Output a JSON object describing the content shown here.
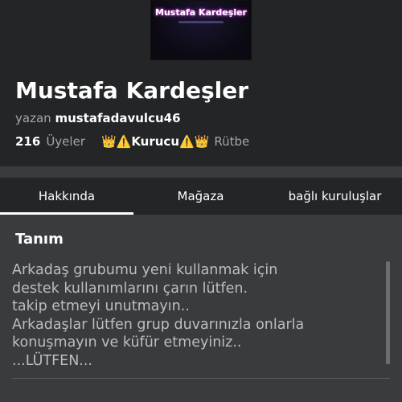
{
  "group": {
    "logo_text": "Mustafa Kardeşler",
    "name": "Mustafa Kardeşler",
    "owner_prefix": "yazan",
    "owner_name": "mustafadavulcu46",
    "member_count": "216",
    "member_label": "Üyeler",
    "rank_value": "👑⚠️Kurucu⚠️👑",
    "rank_label": "Rütbe"
  },
  "tabs": [
    {
      "label": "Hakkında",
      "active": true
    },
    {
      "label": "Mağaza",
      "active": false
    },
    {
      "label": "bağlı kuruluşlar",
      "active": false
    }
  ],
  "about": {
    "section_title": "Tanım",
    "description_lines": [
      "Arkadaş grubumu yeni kullanmak için",
      "destek kullanımlarını çarın lütfen.",
      "takip etmeyi unutmayın..",
      "Arkadaşlar lütfen grup duvarınızla onlarla",
      "konuşmayın ve küfür etmeyiniz..",
      "...LÜTFEN..."
    ]
  },
  "colors": {
    "background": "#393b3d",
    "header_background": "#232527",
    "secondary_text": "#a3a6a8",
    "description_text": "#bdbebe"
  }
}
